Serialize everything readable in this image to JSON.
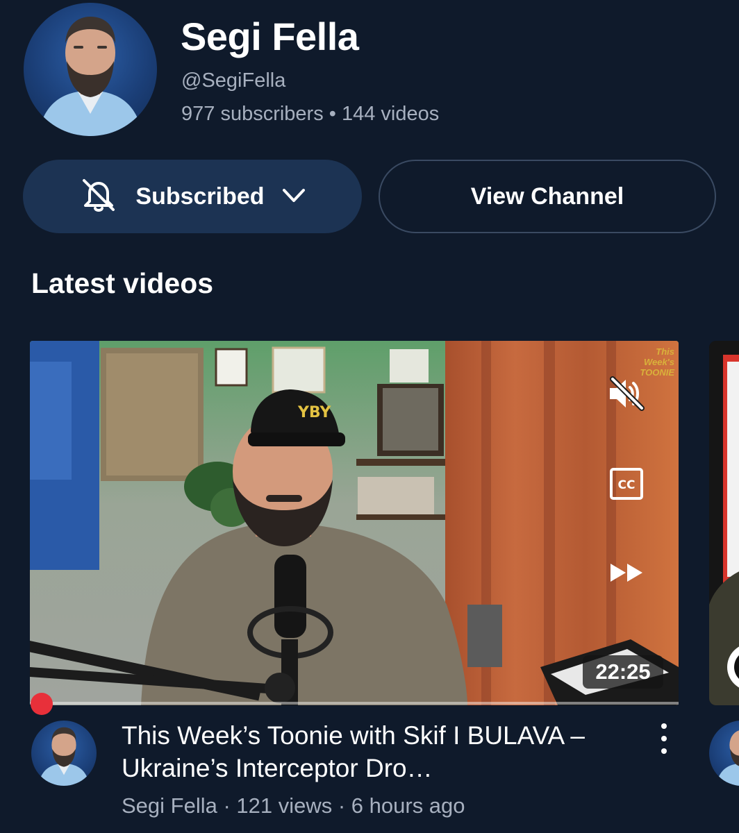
{
  "channel": {
    "name": "Segi Fella",
    "handle": "@SegiFella",
    "stats": "977 subscribers • 144 videos"
  },
  "actions": {
    "subscribed_label": "Subscribed",
    "view_channel_label": "View Channel"
  },
  "section": {
    "title": "Latest videos"
  },
  "video": {
    "title": "This Week’s Toonie with Skif I BULAVA – Ukraine’s Interceptor Dro…",
    "meta": "Segi Fella · 121 views · 6 hours ago",
    "duration": "22:25",
    "watermark": "This Week's TOONIE",
    "progress": 0,
    "overlay_icons": [
      "mute-icon",
      "closed-captions-icon",
      "fast-forward-icon"
    ]
  },
  "colors": {
    "background": "#0f1a2b",
    "subscribed_button": "#1c3353",
    "secondary_text": "#a7b0bf",
    "progress_dot": "#e8303a"
  }
}
